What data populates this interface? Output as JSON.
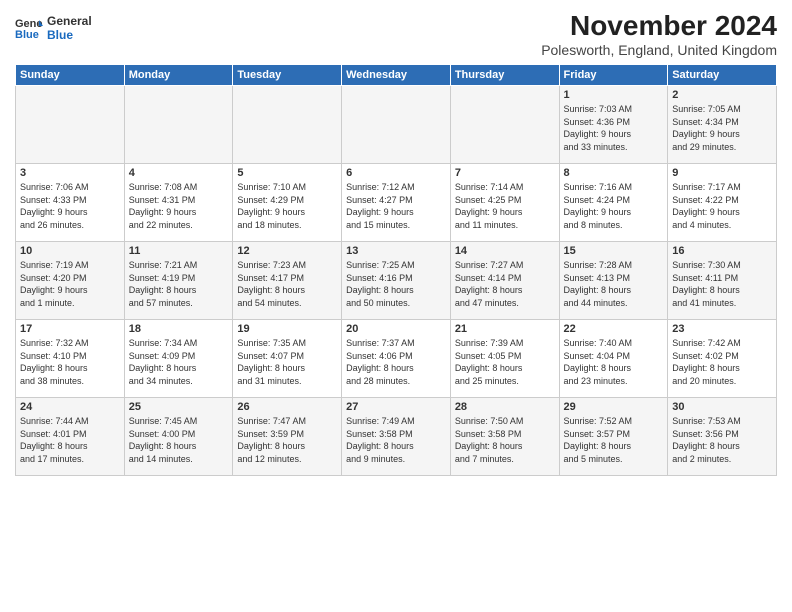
{
  "logo": {
    "line1": "General",
    "line2": "Blue"
  },
  "title": "November 2024",
  "subtitle": "Polesworth, England, United Kingdom",
  "days_of_week": [
    "Sunday",
    "Monday",
    "Tuesday",
    "Wednesday",
    "Thursday",
    "Friday",
    "Saturday"
  ],
  "weeks": [
    [
      {
        "day": "",
        "content": ""
      },
      {
        "day": "",
        "content": ""
      },
      {
        "day": "",
        "content": ""
      },
      {
        "day": "",
        "content": ""
      },
      {
        "day": "",
        "content": ""
      },
      {
        "day": "1",
        "content": "Sunrise: 7:03 AM\nSunset: 4:36 PM\nDaylight: 9 hours\nand 33 minutes."
      },
      {
        "day": "2",
        "content": "Sunrise: 7:05 AM\nSunset: 4:34 PM\nDaylight: 9 hours\nand 29 minutes."
      }
    ],
    [
      {
        "day": "3",
        "content": "Sunrise: 7:06 AM\nSunset: 4:33 PM\nDaylight: 9 hours\nand 26 minutes."
      },
      {
        "day": "4",
        "content": "Sunrise: 7:08 AM\nSunset: 4:31 PM\nDaylight: 9 hours\nand 22 minutes."
      },
      {
        "day": "5",
        "content": "Sunrise: 7:10 AM\nSunset: 4:29 PM\nDaylight: 9 hours\nand 18 minutes."
      },
      {
        "day": "6",
        "content": "Sunrise: 7:12 AM\nSunset: 4:27 PM\nDaylight: 9 hours\nand 15 minutes."
      },
      {
        "day": "7",
        "content": "Sunrise: 7:14 AM\nSunset: 4:25 PM\nDaylight: 9 hours\nand 11 minutes."
      },
      {
        "day": "8",
        "content": "Sunrise: 7:16 AM\nSunset: 4:24 PM\nDaylight: 9 hours\nand 8 minutes."
      },
      {
        "day": "9",
        "content": "Sunrise: 7:17 AM\nSunset: 4:22 PM\nDaylight: 9 hours\nand 4 minutes."
      }
    ],
    [
      {
        "day": "10",
        "content": "Sunrise: 7:19 AM\nSunset: 4:20 PM\nDaylight: 9 hours\nand 1 minute."
      },
      {
        "day": "11",
        "content": "Sunrise: 7:21 AM\nSunset: 4:19 PM\nDaylight: 8 hours\nand 57 minutes."
      },
      {
        "day": "12",
        "content": "Sunrise: 7:23 AM\nSunset: 4:17 PM\nDaylight: 8 hours\nand 54 minutes."
      },
      {
        "day": "13",
        "content": "Sunrise: 7:25 AM\nSunset: 4:16 PM\nDaylight: 8 hours\nand 50 minutes."
      },
      {
        "day": "14",
        "content": "Sunrise: 7:27 AM\nSunset: 4:14 PM\nDaylight: 8 hours\nand 47 minutes."
      },
      {
        "day": "15",
        "content": "Sunrise: 7:28 AM\nSunset: 4:13 PM\nDaylight: 8 hours\nand 44 minutes."
      },
      {
        "day": "16",
        "content": "Sunrise: 7:30 AM\nSunset: 4:11 PM\nDaylight: 8 hours\nand 41 minutes."
      }
    ],
    [
      {
        "day": "17",
        "content": "Sunrise: 7:32 AM\nSunset: 4:10 PM\nDaylight: 8 hours\nand 38 minutes."
      },
      {
        "day": "18",
        "content": "Sunrise: 7:34 AM\nSunset: 4:09 PM\nDaylight: 8 hours\nand 34 minutes."
      },
      {
        "day": "19",
        "content": "Sunrise: 7:35 AM\nSunset: 4:07 PM\nDaylight: 8 hours\nand 31 minutes."
      },
      {
        "day": "20",
        "content": "Sunrise: 7:37 AM\nSunset: 4:06 PM\nDaylight: 8 hours\nand 28 minutes."
      },
      {
        "day": "21",
        "content": "Sunrise: 7:39 AM\nSunset: 4:05 PM\nDaylight: 8 hours\nand 25 minutes."
      },
      {
        "day": "22",
        "content": "Sunrise: 7:40 AM\nSunset: 4:04 PM\nDaylight: 8 hours\nand 23 minutes."
      },
      {
        "day": "23",
        "content": "Sunrise: 7:42 AM\nSunset: 4:02 PM\nDaylight: 8 hours\nand 20 minutes."
      }
    ],
    [
      {
        "day": "24",
        "content": "Sunrise: 7:44 AM\nSunset: 4:01 PM\nDaylight: 8 hours\nand 17 minutes."
      },
      {
        "day": "25",
        "content": "Sunrise: 7:45 AM\nSunset: 4:00 PM\nDaylight: 8 hours\nand 14 minutes."
      },
      {
        "day": "26",
        "content": "Sunrise: 7:47 AM\nSunset: 3:59 PM\nDaylight: 8 hours\nand 12 minutes."
      },
      {
        "day": "27",
        "content": "Sunrise: 7:49 AM\nSunset: 3:58 PM\nDaylight: 8 hours\nand 9 minutes."
      },
      {
        "day": "28",
        "content": "Sunrise: 7:50 AM\nSunset: 3:58 PM\nDaylight: 8 hours\nand 7 minutes."
      },
      {
        "day": "29",
        "content": "Sunrise: 7:52 AM\nSunset: 3:57 PM\nDaylight: 8 hours\nand 5 minutes."
      },
      {
        "day": "30",
        "content": "Sunrise: 7:53 AM\nSunset: 3:56 PM\nDaylight: 8 hours\nand 2 minutes."
      }
    ]
  ]
}
